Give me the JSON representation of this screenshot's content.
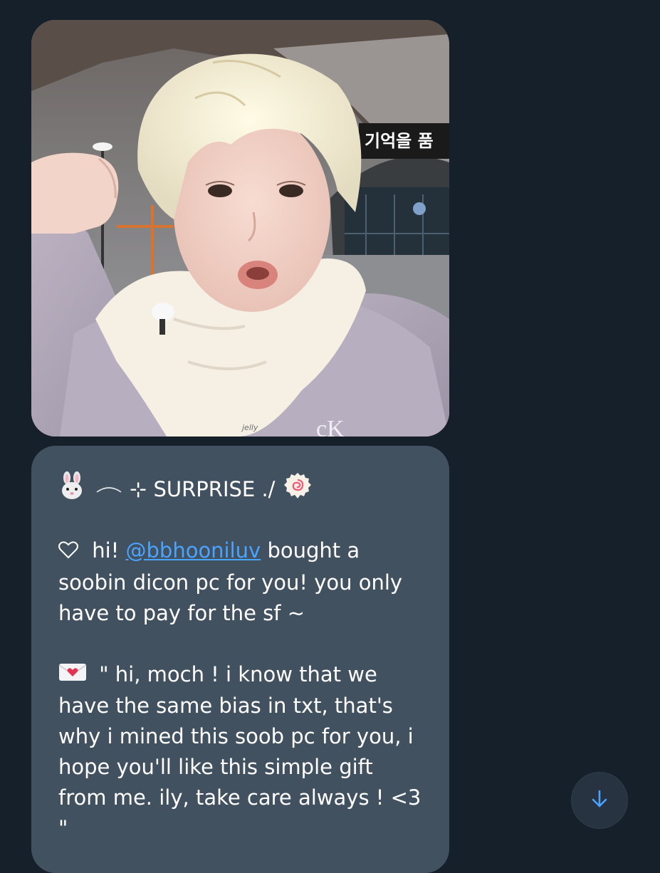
{
  "photo": {
    "sign_text": "기억을 품",
    "watermark": "jelly",
    "jacket_logo": "cK"
  },
  "message": {
    "title": "⊹ SURPRISE ./",
    "line1_prefix": "hi!",
    "mention": "@bbhooniluv",
    "line1_suffix": "bought a",
    "line2": "soobin dicon pc for you! you only",
    "line3": "have to pay for the sf ~",
    "quote_line1": "\" hi, moch ! i know that we",
    "quote_line2": "have the same bias in txt, that's",
    "quote_line3": "why i mined this soob pc for you, i",
    "quote_line4": "hope you'll like this simple gift",
    "quote_line5": "from me. ily, take care always ! <3",
    "quote_line6": "\""
  },
  "icons": {
    "rabbit": "rabbit-face-icon",
    "swoosh": "swoosh-icon",
    "narutomaki": "fish-cake-icon",
    "heart": "heart-outline-icon",
    "envelope": "love-letter-icon",
    "scroll": "arrow-down-icon"
  },
  "colors": {
    "background": "#15202b",
    "bubble": "#425160",
    "link": "#4aa3ff",
    "scroll_arrow": "#4aa3ff"
  }
}
